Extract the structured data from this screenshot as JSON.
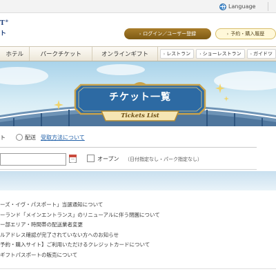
{
  "topbar": {
    "language_label": "Language"
  },
  "logo": {
    "line1": "T",
    "line1_mark": "®",
    "line2": "ト"
  },
  "header": {
    "login_label": "ログイン／ユーザー登録",
    "history_label": "予約・購入履歴"
  },
  "nav": {
    "items": [
      {
        "label": "ホテル"
      },
      {
        "label": "パークチケット"
      },
      {
        "label": "オンラインギフト"
      }
    ],
    "sub_items": [
      {
        "label": "レストラン"
      },
      {
        "label": "ショーレストラン"
      },
      {
        "label": "ガイドツ"
      }
    ]
  },
  "hero": {
    "title": "チケット一覧",
    "subtitle": "Tickets List"
  },
  "delivery": {
    "option1_label": "ト",
    "option2_label": "配送",
    "link_label": "受取方法について"
  },
  "date": {
    "open_label": "オープン",
    "open_note": "（日付指定なし・パーク指定なし）"
  },
  "news": [
    {
      "text": "ーズ・イヴ・パスポート」当選通知について"
    },
    {
      "text": "ーランド「メインエントランス」のリニューアルに伴う閉園について"
    },
    {
      "text": "ー部エリア・時間帯の配送業者変更"
    },
    {
      "text": "ルアドレス確認が完了されていない方へのお知らせ"
    },
    {
      "text": "予約・購入サイト】ご利用いただけるクレジットカードについて"
    },
    {
      "text": "ギフトパスポートの販売について"
    }
  ],
  "colors": {
    "accent_gold": "#9b7424",
    "plaque_blue": "#2d6aa3",
    "link_blue": "#1f5fa8",
    "sky": "#a9d3ea"
  }
}
